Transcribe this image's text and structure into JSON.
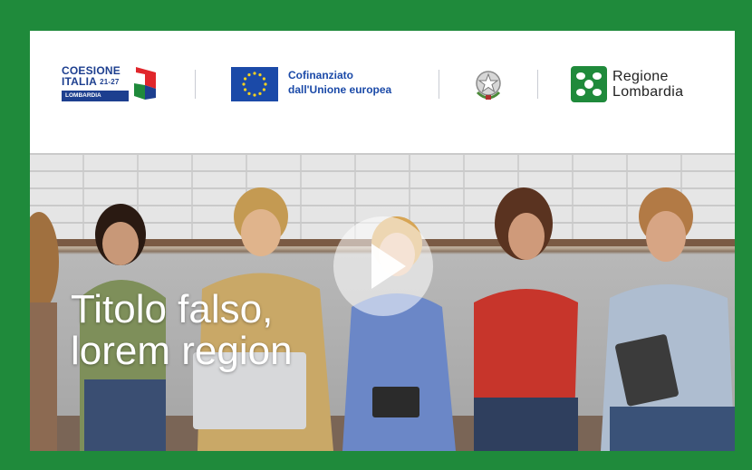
{
  "header": {
    "coesione": {
      "line1": "COESIONE",
      "line2": "ITALIA",
      "years": "21-27",
      "badge": "LOMBARDIA"
    },
    "eu": {
      "line1": "Cofinanziato",
      "line2": "dall'Unione europea"
    },
    "regione": {
      "line1": "Regione",
      "line2": "Lombardia"
    }
  },
  "hero": {
    "headline_line1": "Titolo falso,",
    "headline_line2": "lorem region"
  },
  "colors": {
    "frame": "#1f8a3b",
    "eu_blue": "#1b4aa8",
    "coesione_blue": "#1d3f8f"
  },
  "icons": [
    "coesione-logo-icon",
    "eu-flag-icon",
    "italian-emblem-icon",
    "regione-lombardia-icon",
    "play-icon"
  ]
}
